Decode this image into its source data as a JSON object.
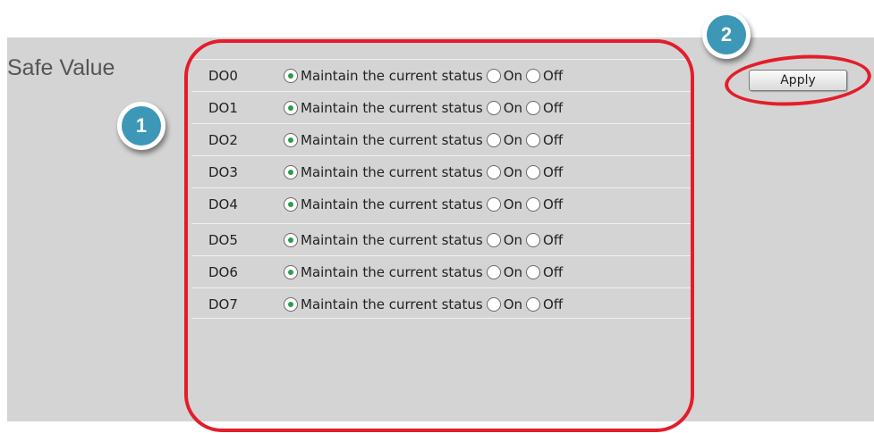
{
  "section": {
    "title": "Safe Value"
  },
  "options": [
    "Maintain the current status",
    "On",
    "Off"
  ],
  "rows": [
    {
      "label": "DO0",
      "selected": "Maintain the current status"
    },
    {
      "label": "DO1",
      "selected": "Maintain the current status"
    },
    {
      "label": "DO2",
      "selected": "Maintain the current status"
    },
    {
      "label": "DO3",
      "selected": "Maintain the current status"
    },
    {
      "label": "DO4",
      "selected": "Maintain the current status"
    },
    {
      "label": "DO5",
      "selected": "Maintain the current status"
    },
    {
      "label": "DO6",
      "selected": "Maintain the current status"
    },
    {
      "label": "DO7",
      "selected": "Maintain the current status"
    }
  ],
  "apply_button": {
    "label": "Apply"
  },
  "callouts": {
    "badge1": "1",
    "badge2": "2"
  },
  "colors": {
    "callout_red": "#e41d2a",
    "badge_blue": "#3d97b6",
    "radio_dot": "#2f9a4a",
    "panel_bg": "#d4d4d4"
  }
}
